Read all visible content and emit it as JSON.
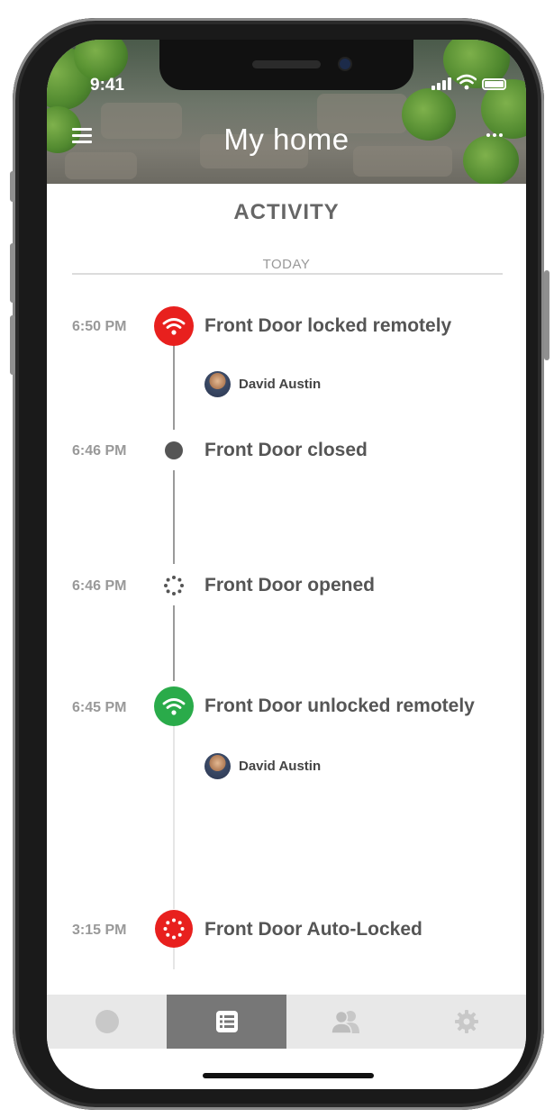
{
  "status_bar": {
    "time": "9:41"
  },
  "header": {
    "title": "My home"
  },
  "activity": {
    "section_title": "ACTIVITY",
    "day_label": "TODAY",
    "events": [
      {
        "time": "6:50 PM",
        "text": "Front Door locked remotely",
        "user": "David Austin",
        "status_icon": "wifi-icon",
        "color": "#e8201e"
      },
      {
        "time": "6:46 PM",
        "text": "Front Door closed",
        "status_icon": "dot-icon",
        "color": "#555555"
      },
      {
        "time": "6:46 PM",
        "text": "Front Door opened",
        "status_icon": "spinner-icon",
        "color": "#555555"
      },
      {
        "time": "6:45 PM",
        "text": "Front Door unlocked remotely",
        "user": "David Austin",
        "status_icon": "wifi-icon",
        "color": "#2aab4a"
      },
      {
        "time": "3:15 PM",
        "text": "Front Door Auto-Locked",
        "status_icon": "spinner-icon",
        "color": "#e8201e"
      }
    ]
  },
  "tabbar": {
    "tabs": [
      {
        "icon": "circle-icon",
        "active": false
      },
      {
        "icon": "list-icon",
        "active": true
      },
      {
        "icon": "users-icon",
        "active": false
      },
      {
        "icon": "gear-icon",
        "active": false
      }
    ]
  },
  "colors": {
    "red": "#e8201e",
    "green": "#2aab4a",
    "active_tab": "#777777",
    "tabbar_bg": "#e8e8e8"
  }
}
